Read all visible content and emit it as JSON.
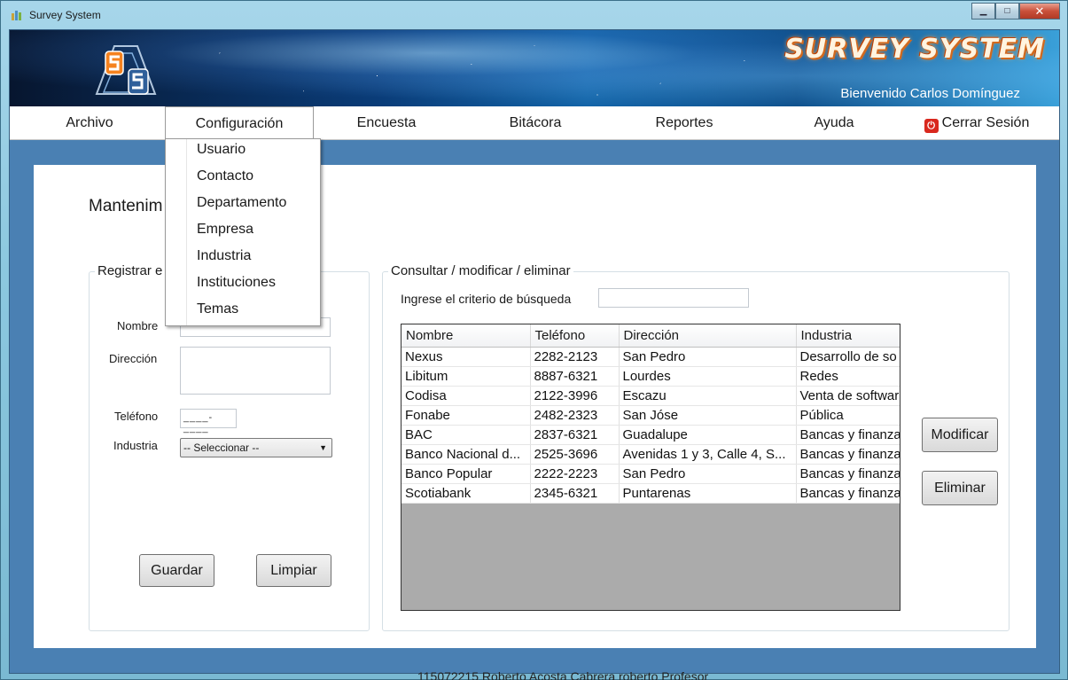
{
  "window": {
    "title": "Survey System"
  },
  "banner": {
    "brand": "SURVEY SYSTEM",
    "welcome": "Bienvenido Carlos Domínguez"
  },
  "menu": {
    "items": [
      "Archivo",
      "Configuración",
      "Encuesta",
      "Bitácora",
      "Reportes",
      "Ayuda"
    ],
    "logout": "Cerrar Sesión",
    "open_menu": "Configuración",
    "dropdown": [
      "Usuario",
      "Contacto",
      "Departamento",
      "Empresa",
      "Industria",
      "Instituciones",
      "Temas"
    ]
  },
  "page": {
    "heading": "Mantenim"
  },
  "register": {
    "title": "Registrar e",
    "nombre_label": "Nombre",
    "direccion_label": "Dirección",
    "telefono_label": "Teléfono",
    "telefono_mask": "____-____",
    "industria_label": "Industria",
    "industria_value": "-- Seleccionar --",
    "save": "Guardar",
    "clear": "Limpiar"
  },
  "query": {
    "title": "Consultar / modificar / eliminar",
    "search_label": "Ingrese el criterio de búsqueda",
    "search_value": "",
    "modify": "Modificar",
    "delete": "Eliminar",
    "columns": [
      "Nombre",
      "Teléfono",
      "Dirección",
      "Industria"
    ],
    "rows": [
      [
        "Nexus",
        "2282-2123",
        "San Pedro",
        "Desarrollo de so"
      ],
      [
        "Libitum",
        "8887-6321",
        "Lourdes",
        "Redes"
      ],
      [
        "Codisa",
        "2122-3996",
        "Escazu",
        "Venta de softwar"
      ],
      [
        "Fonabe",
        "2482-2323",
        "San Jóse",
        "Pública"
      ],
      [
        "BAC",
        "2837-6321",
        "Guadalupe",
        "Bancas y finanza"
      ],
      [
        "Banco Nacional d...",
        "2525-3696",
        "Avenidas 1 y 3, Calle 4, S...",
        "Bancas y finanza"
      ],
      [
        "Banco Popular",
        "2222-2223",
        "San Pedro",
        "Bancas y finanza"
      ],
      [
        "Scotiabank",
        "2345-6321",
        "Puntarenas",
        "Bancas y finanza"
      ]
    ]
  },
  "background_strip": "115072215   Roberto        Acosta         Cabrera        roberto        Profesor"
}
